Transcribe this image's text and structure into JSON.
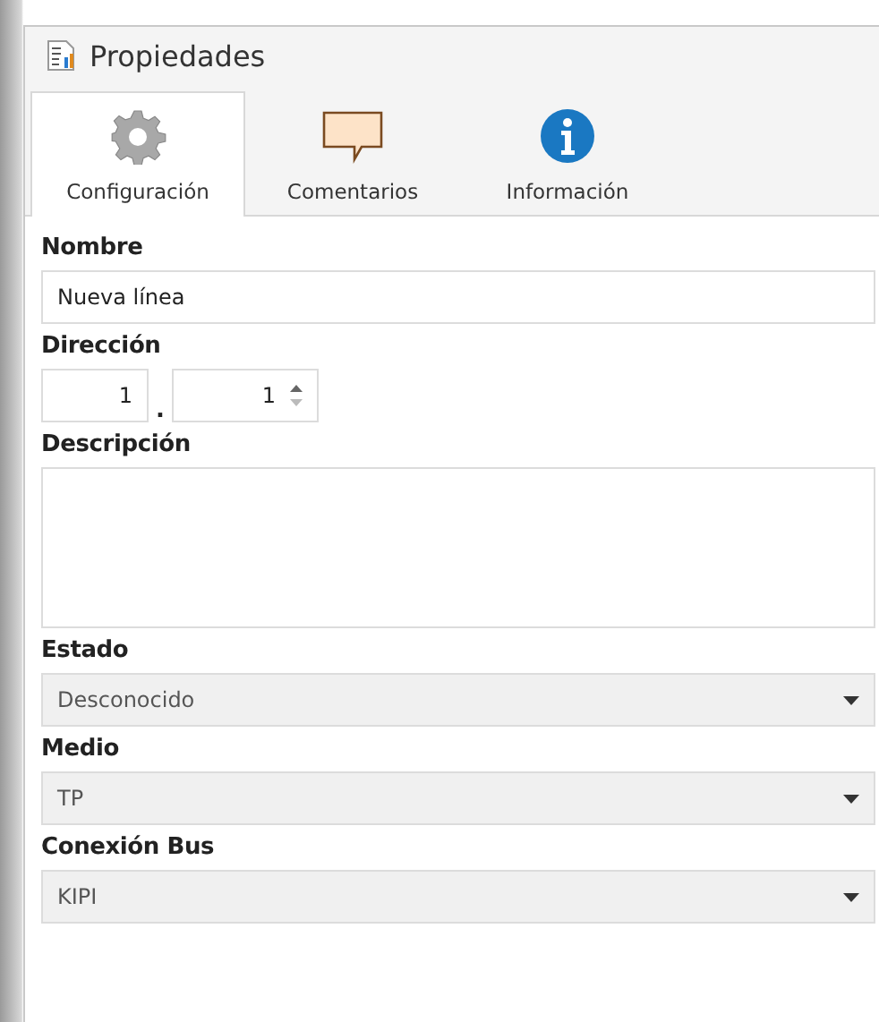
{
  "window": {
    "title": "Propiedades"
  },
  "tabs": [
    {
      "label": "Configuración",
      "selected": true,
      "kind": "gear"
    },
    {
      "label": "Comentarios",
      "selected": false,
      "kind": "comment"
    },
    {
      "label": "Información",
      "selected": false,
      "kind": "info"
    }
  ],
  "fields": [
    {
      "kind": "text",
      "label": "Nombre",
      "value": "Nueva línea"
    },
    {
      "kind": "address",
      "label": "Dirección",
      "parts": [
        "1",
        "1"
      ],
      "separator": "."
    },
    {
      "kind": "textarea",
      "label": "Descripción"
    },
    {
      "kind": "dropdown",
      "label": "Estado",
      "value": "Desconocido",
      "disabled": true
    },
    {
      "kind": "dropdown",
      "label": "Medio",
      "value": "TP",
      "disabled": true
    },
    {
      "kind": "dropdown",
      "label": "Conexión Bus",
      "value": "KIPI",
      "disabled": true
    }
  ]
}
